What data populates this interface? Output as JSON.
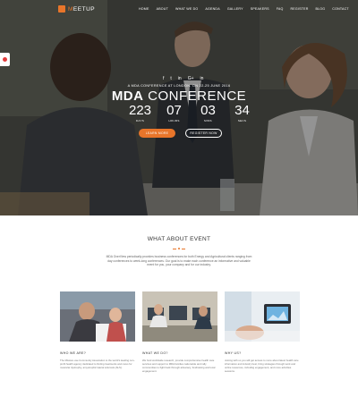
{
  "brand": {
    "logo_prefix": "M",
    "logo_rest": "EETUP"
  },
  "nav": {
    "items": [
      "HOME",
      "ABOUT",
      "WHAT WE DO",
      "AGENDA",
      "GALLERY",
      "SPEAKERS",
      "FAQ",
      "REGISTER",
      "BLOG",
      "CONTACT"
    ]
  },
  "hero": {
    "social": [
      "f",
      "t",
      "in",
      "G+",
      "in"
    ],
    "subtitle": "A MDA CONFERENCE AT LONDON. ON 22-25 JUNE 2016",
    "title_bold": "MDA",
    "title_rest": " CONFERENCE",
    "countdown": [
      {
        "value": "223",
        "label": "DAYS"
      },
      {
        "value": "07",
        "label": "HOURS"
      },
      {
        "value": "03",
        "label": "MINS"
      },
      {
        "value": "34",
        "label": "SECS"
      }
    ],
    "cta_primary": "LEARN MORE",
    "cta_secondary": "REGISTER NOW"
  },
  "about": {
    "title": "WHAT ABOUT EVENT",
    "intro": "MDA OverView periodically provides business conferences for both Energy and Agricultural clients ranging from day conferences to week-long conferences. Our goal is to make each conference an informative and valuable event for you, your company and for our industry."
  },
  "cards": [
    {
      "title": "WHO WE ARE?",
      "text": "The Mission-use Community Association is the world's leading non-profit health agency dedicated to finding treatments and cures for muscular dystrophy, amyotrophic lateral sclerosis (ALS)."
    },
    {
      "title": "WHAT WE DO?",
      "text": "We fund worldwide research, provide comprehensive health care services and support to MDA families nationwide and rally communities to fight back through advocacy, fundraising and local engagement."
    },
    {
      "title": "WHY US?",
      "text": "Joining with us you will get access to more about latest health care information and industry best, bring strategies through work and online resources, including engagement, and more activities sessions."
    }
  ],
  "colors": {
    "accent": "#e8752a",
    "overlay": "#141414",
    "white": "#ffffff"
  }
}
